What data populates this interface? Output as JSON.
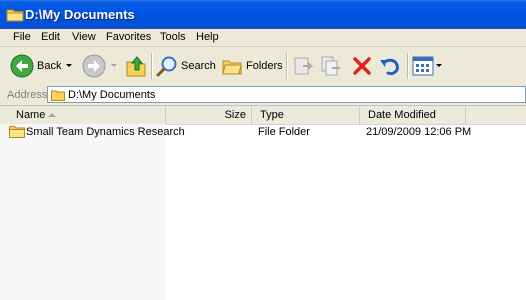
{
  "window": {
    "title": "D:\\My Documents"
  },
  "menu": {
    "items": [
      "File",
      "Edit",
      "View",
      "Favorites",
      "Tools",
      "Help"
    ]
  },
  "toolbar": {
    "back_label": "Back",
    "search_label": "Search",
    "folders_label": "Folders"
  },
  "address": {
    "label": "Address",
    "path": "D:\\My Documents"
  },
  "list": {
    "columns": [
      "Name",
      "Size",
      "Type",
      "Date Modified"
    ],
    "sorted_column": "Name",
    "rows": [
      {
        "name": "Small Team Dynamics Research",
        "size": "",
        "type": "File Folder",
        "date_modified": "21/09/2009 12:06 PM"
      }
    ]
  },
  "colors": {
    "title_bar": "#0055e5",
    "chrome": "#ece9d8",
    "folder": "#f6d25b"
  },
  "icons": [
    "folder-icon",
    "back-icon",
    "forward-icon",
    "up-icon",
    "search-icon",
    "folders-icon",
    "move-to-icon",
    "copy-to-icon",
    "delete-icon",
    "undo-icon",
    "views-icon"
  ]
}
